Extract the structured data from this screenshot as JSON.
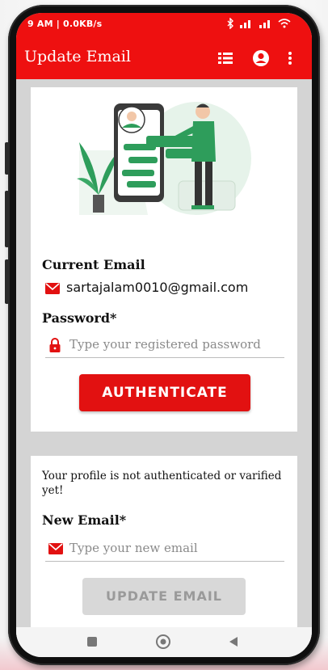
{
  "status_bar": {
    "time_and_speed": "9 AM | 0.0KB/s",
    "icons": [
      "bluetooth-icon",
      "signal-icon",
      "signal-icon",
      "wifi-icon"
    ]
  },
  "app_bar": {
    "title": "Update Email",
    "actions": [
      "list-icon",
      "account-icon",
      "more-vert-icon"
    ]
  },
  "auth_card": {
    "current_email_label": "Current Email",
    "current_email_value": "sartajalam0010@gmail.com",
    "password_label": "Password*",
    "password_placeholder": "Type your registered password",
    "authenticate_button": "AUTHENTICATE"
  },
  "update_card": {
    "message": "Your profile is not authenticated or varified yet!",
    "new_email_label": "New Email*",
    "new_email_placeholder": "Type your new email",
    "update_button": "UPDATE EMAIL"
  },
  "nav_bar": {
    "buttons": [
      "recents-icon",
      "home-icon",
      "back-icon"
    ]
  },
  "colors": {
    "primary": "#ee1010",
    "button_disabled": "#d8d8d8",
    "illustration_green": "#2e9d5b"
  }
}
